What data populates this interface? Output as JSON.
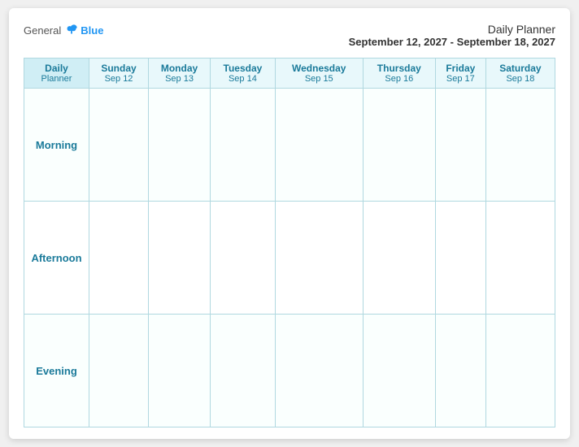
{
  "header": {
    "logo_general": "General",
    "logo_blue": "Blue",
    "planner_title": "Daily Planner",
    "date_range": "September 12, 2027 - September 18, 2027"
  },
  "columns": [
    {
      "id": "label",
      "top": "Daily",
      "bottom": "Planner",
      "is_label": true
    },
    {
      "id": "sun",
      "top": "Sunday",
      "bottom": "Sep 12"
    },
    {
      "id": "mon",
      "top": "Monday",
      "bottom": "Sep 13"
    },
    {
      "id": "tue",
      "top": "Tuesday",
      "bottom": "Sep 14"
    },
    {
      "id": "wed",
      "top": "Wednesday",
      "bottom": "Sep 15"
    },
    {
      "id": "thu",
      "top": "Thursday",
      "bottom": "Sep 16"
    },
    {
      "id": "fri",
      "top": "Friday",
      "bottom": "Sep 17"
    },
    {
      "id": "sat",
      "top": "Saturday",
      "bottom": "Sep 18"
    }
  ],
  "rows": [
    {
      "id": "morning",
      "label": "Morning"
    },
    {
      "id": "afternoon",
      "label": "Afternoon"
    },
    {
      "id": "evening",
      "label": "Evening"
    }
  ]
}
